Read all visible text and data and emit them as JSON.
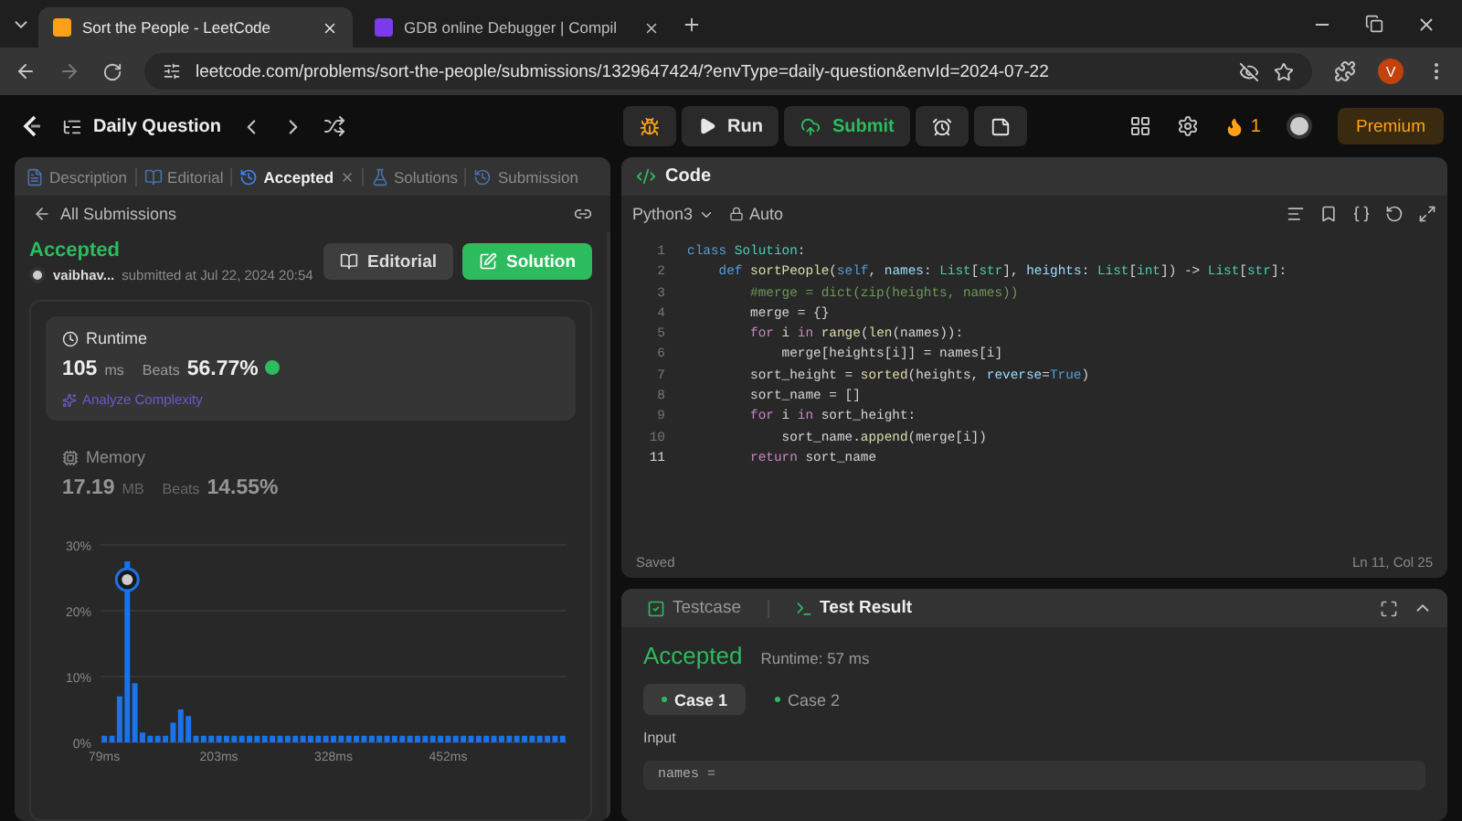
{
  "browser": {
    "tabs": [
      {
        "title": "Sort the People - LeetCode",
        "selected": true
      },
      {
        "title": "GDB online Debugger | Compil",
        "selected": false
      }
    ],
    "url": "leetcode.com/problems/sort-the-people/submissions/1329647424/?envType=daily-question&envId=2024-07-22",
    "profile": "V"
  },
  "toolbar": {
    "problem_list": "Daily Question",
    "run": "Run",
    "submit": "Submit",
    "streak": "1",
    "premium": "Premium"
  },
  "left_tabs": [
    {
      "label": "Description",
      "selected": false,
      "closable": false
    },
    {
      "label": "Editorial",
      "selected": false,
      "closable": false
    },
    {
      "label": "Accepted",
      "selected": true,
      "closable": true
    },
    {
      "label": "Solutions",
      "selected": false,
      "closable": false
    },
    {
      "label": "Submission",
      "selected": false,
      "closable": false
    }
  ],
  "back_link": "All Submissions",
  "submission": {
    "status": "Accepted",
    "user": "vaibhav...",
    "submitted": "submitted at Jul 22, 2024 20:54",
    "buttons": [
      {
        "label": "Editorial",
        "kind": "secondary"
      },
      {
        "label": "Solution",
        "kind": "primary"
      }
    ]
  },
  "stats": [
    {
      "title": "Runtime",
      "kind": "runtime",
      "value": "105",
      "unit": "ms",
      "beats_label": "Beats",
      "beats": "56.77%",
      "extra": "Analyze Complexity",
      "selected": true
    },
    {
      "title": "Memory",
      "kind": "memory",
      "value": "17.19",
      "unit": "MB",
      "beats_label": "Beats",
      "beats": "14.55%",
      "selected": false
    }
  ],
  "chart_data": {
    "type": "bar",
    "categories": [
      "79ms",
      null,
      null,
      null,
      null,
      null,
      null,
      null,
      null,
      null,
      null,
      null,
      null,
      null,
      null,
      "203ms",
      null,
      null,
      null,
      null,
      null,
      null,
      null,
      null,
      null,
      null,
      null,
      null,
      null,
      null,
      "328ms",
      null,
      null,
      null,
      null,
      null,
      null,
      null,
      null,
      null,
      null,
      null,
      null,
      null,
      null,
      "452ms",
      null,
      null,
      null,
      null,
      null,
      null,
      null,
      null,
      null,
      null,
      null,
      null,
      null,
      null,
      null
    ],
    "values": [
      1,
      1,
      7,
      27.5,
      9,
      1.5,
      1,
      1,
      1,
      3,
      5,
      4,
      1,
      1,
      1,
      1,
      1,
      1,
      1,
      1,
      1,
      1,
      1,
      1,
      1,
      1,
      1,
      1,
      1,
      1,
      1,
      1,
      1,
      1,
      1,
      1,
      1,
      1,
      1,
      1,
      1,
      1,
      1,
      1,
      1,
      1,
      1,
      1,
      1,
      1,
      1,
      1,
      1,
      1,
      1,
      1,
      1,
      1,
      1,
      1,
      1
    ],
    "yticks": [
      {
        "value": 0,
        "label": "0%"
      },
      {
        "value": 10,
        "label": "10%"
      },
      {
        "value": 20,
        "label": "20%"
      },
      {
        "value": 30,
        "label": "30%"
      }
    ],
    "ylim": [
      0,
      30
    ]
  },
  "code_panel": {
    "title": "Code",
    "language": "Python3",
    "mode": "Auto",
    "status": "Saved",
    "cursor": "Ln 11, Col 25",
    "lines": [
      {
        "number": "1",
        "current": false,
        "tokens": [
          {
            "text": "class ",
            "kind": "kw"
          },
          {
            "text": "Solution",
            "kind": "cls"
          },
          {
            "text": ":",
            "kind": "p"
          }
        ]
      },
      {
        "number": "2",
        "current": false,
        "tokens": [
          {
            "text": "    def ",
            "kind": "kw"
          },
          {
            "text": "sortPeople",
            "kind": "fn"
          },
          {
            "text": "(",
            "kind": "p"
          },
          {
            "text": "self",
            "kind": "kw"
          },
          {
            "text": ", ",
            "kind": "p"
          },
          {
            "text": "names",
            "kind": "var"
          },
          {
            "text": ": ",
            "kind": "p"
          },
          {
            "text": "List",
            "kind": "cls"
          },
          {
            "text": "[",
            "kind": "p"
          },
          {
            "text": "str",
            "kind": "cls"
          },
          {
            "text": "], ",
            "kind": "p"
          },
          {
            "text": "heights",
            "kind": "var"
          },
          {
            "text": ": ",
            "kind": "p"
          },
          {
            "text": "List",
            "kind": "cls"
          },
          {
            "text": "[",
            "kind": "p"
          },
          {
            "text": "int",
            "kind": "cls"
          },
          {
            "text": "]) -> ",
            "kind": "p"
          },
          {
            "text": "List",
            "kind": "cls"
          },
          {
            "text": "[",
            "kind": "p"
          },
          {
            "text": "str",
            "kind": "cls"
          },
          {
            "text": "]:",
            "kind": "p"
          }
        ]
      },
      {
        "number": "3",
        "current": false,
        "tokens": [
          {
            "text": "        #merge = dict(zip(heights, names))",
            "kind": "cm"
          }
        ]
      },
      {
        "number": "4",
        "current": false,
        "tokens": [
          {
            "text": "        merge = {}",
            "kind": "p"
          }
        ]
      },
      {
        "number": "5",
        "current": false,
        "tokens": [
          {
            "text": "        for",
            "kind": "ctl"
          },
          {
            "text": " i ",
            "kind": "p"
          },
          {
            "text": "in",
            "kind": "ctl"
          },
          {
            "text": " range",
            "kind": "fn"
          },
          {
            "text": "(",
            "kind": "p"
          },
          {
            "text": "len",
            "kind": "fn"
          },
          {
            "text": "(names)):",
            "kind": "p"
          }
        ]
      },
      {
        "number": "6",
        "current": false,
        "tokens": [
          {
            "text": "            merge[heights[i]] = names[i]",
            "kind": "p"
          }
        ]
      },
      {
        "number": "7",
        "current": false,
        "tokens": [
          {
            "text": "        sort_height = ",
            "kind": "p"
          },
          {
            "text": "sorted",
            "kind": "fn"
          },
          {
            "text": "(heights, ",
            "kind": "p"
          },
          {
            "text": "reverse",
            "kind": "var"
          },
          {
            "text": "=",
            "kind": "p"
          },
          {
            "text": "True",
            "kind": "kw"
          },
          {
            "text": ")",
            "kind": "p"
          }
        ]
      },
      {
        "number": "8",
        "current": false,
        "tokens": [
          {
            "text": "        sort_name = []",
            "kind": "p"
          }
        ]
      },
      {
        "number": "9",
        "current": false,
        "tokens": [
          {
            "text": "        for",
            "kind": "ctl"
          },
          {
            "text": " i ",
            "kind": "p"
          },
          {
            "text": "in",
            "kind": "ctl"
          },
          {
            "text": " sort_height:",
            "kind": "p"
          }
        ]
      },
      {
        "number": "10",
        "current": false,
        "tokens": [
          {
            "text": "            sort_name.",
            "kind": "p"
          },
          {
            "text": "append",
            "kind": "fn"
          },
          {
            "text": "(merge[i])",
            "kind": "p"
          }
        ]
      },
      {
        "number": "11",
        "current": true,
        "tokens": [
          {
            "text": "        return",
            "kind": "ctl"
          },
          {
            "text": " sort_name",
            "kind": "p"
          }
        ]
      }
    ]
  },
  "test_panel": {
    "tabs": [
      {
        "label": "Testcase",
        "selected": false
      },
      {
        "label": "Test Result",
        "selected": true
      }
    ],
    "status": "Accepted",
    "runtime": "Runtime: 57 ms",
    "cases": [
      {
        "label": "Case 1",
        "selected": true
      },
      {
        "label": "Case 2",
        "selected": false
      }
    ],
    "input_label": "Input",
    "input_value": "names ="
  }
}
